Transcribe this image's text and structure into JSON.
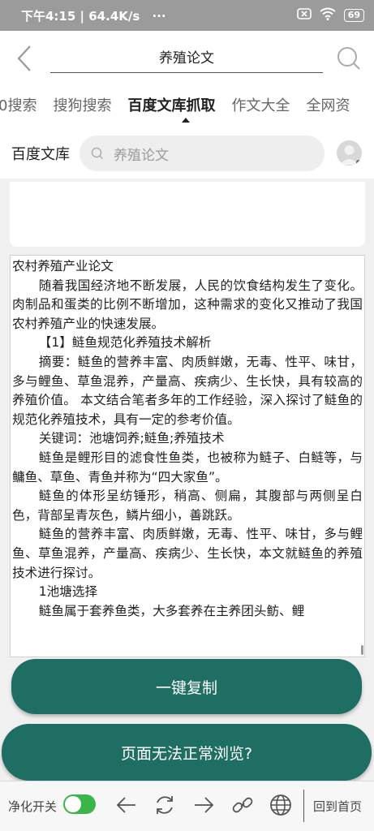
{
  "status_bar": {
    "time_speed": "下午4:15 | 64.4K/s",
    "dots": "···",
    "battery": "69"
  },
  "header": {
    "title": "养殖论文"
  },
  "tabs": [
    {
      "label": "0搜索"
    },
    {
      "label": "搜狗搜索"
    },
    {
      "label": "百度文库抓取"
    },
    {
      "label": "作文大全"
    },
    {
      "label": "全网资"
    }
  ],
  "site_bar": {
    "site_name": "百度文库",
    "search_text": "养殖论文"
  },
  "document": {
    "paragraphs": [
      {
        "text": "农村养殖产业论文",
        "indent": false
      },
      {
        "text": "随着我国经济地不断发展，人民的饮食结构发生了变化。肉制品和蛋类的比例不断增加，这种需求的变化又推动了我国农村养殖产业的快速发展。",
        "indent": true
      },
      {
        "text": "【1】鲢鱼规范化养殖技术解析",
        "indent": true
      },
      {
        "text": "摘要：鲢鱼的营养丰富、肉质鲜嫩，无毒、性平、味甘，多与鲤鱼、草鱼混养，产量高、疾病少、生长快，具有较高的养殖价值。           本文结合笔者多年的工作经验，深入探讨了鲢鱼的规范化养殖技术，具有一定的参考价值。",
        "indent": true
      },
      {
        "text": "关键词：池塘饲养;鲢鱼;养殖技术",
        "indent": true
      },
      {
        "text": "鲢鱼是鲤形目的滤食性鱼类，也被称为鲢子、白鲢等，与鳙鱼、草鱼、青鱼并称为“四大家鱼”。",
        "indent": true
      },
      {
        "text": "鲢鱼的体形呈纺锤形，稍高、侧扁，其腹部与两侧呈白色，背部呈青灰色，鳞片细小，善跳跃。",
        "indent": true
      },
      {
        "text": "鲢鱼的营养丰富、肉质鲜嫩，无毒、性平、味甘，多与鲤鱼、草鱼混养，产量高、疾病少、生长快，本文就鲢鱼的养殖技术进行探讨。",
        "indent": true
      },
      {
        "text": "1池塘选择",
        "indent": true
      },
      {
        "text": "鲢鱼属于套养鱼类，大多套养在主养团头鲂、鲤",
        "indent": true
      }
    ]
  },
  "buttons": {
    "copy": "一键复制",
    "help": "页面无法正常浏览?"
  },
  "bottom_bar": {
    "purify_label": "净化开关",
    "purify_on": true,
    "home_label": "回到首页"
  },
  "colors": {
    "accent": "#1f6e63",
    "toggle_on": "#39b54a",
    "status_bar": "#9b9b9b"
  }
}
